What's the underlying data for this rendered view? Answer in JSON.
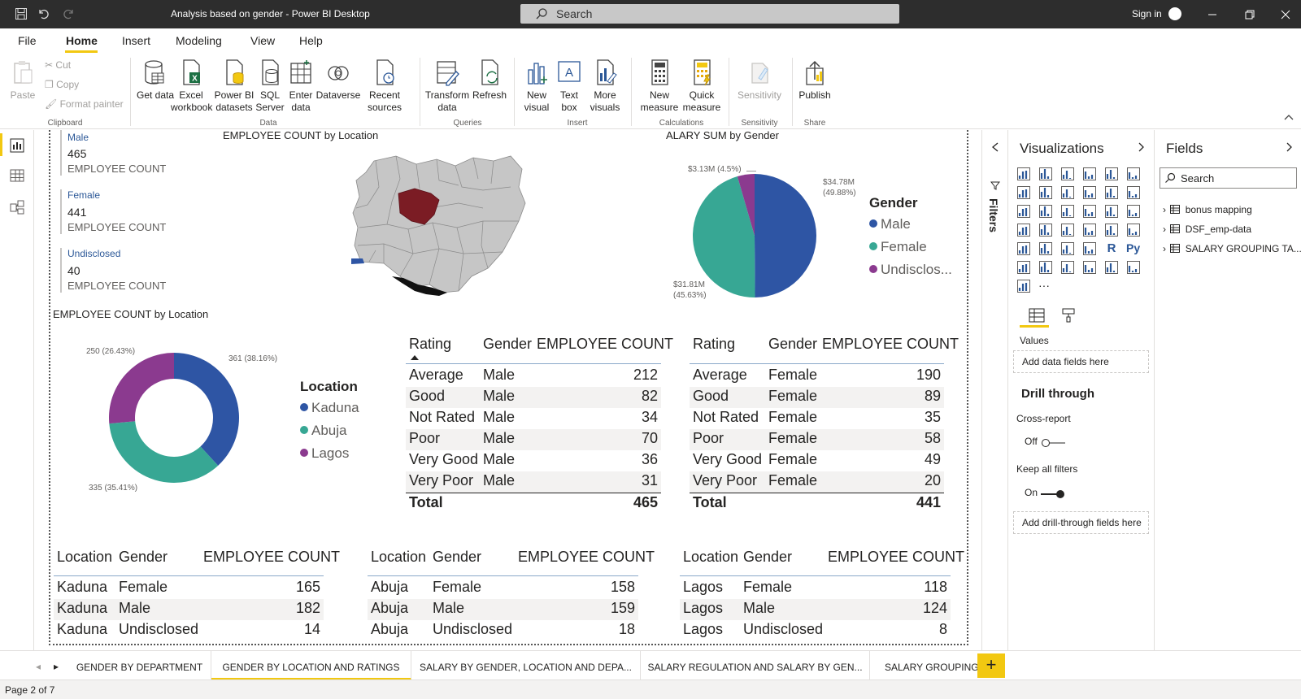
{
  "window": {
    "title": "Analysis based on gender - Power BI Desktop",
    "search_placeholder": "Search",
    "sign_in": "Sign in"
  },
  "menu": [
    "File",
    "Home",
    "Insert",
    "Modeling",
    "View",
    "Help"
  ],
  "ribbon": {
    "clipboard": {
      "paste": "Paste",
      "cut": "Cut",
      "copy": "Copy",
      "format_painter": "Format painter",
      "group": "Clipboard"
    },
    "data": {
      "get_data": "Get data",
      "excel_workbook": "Excel workbook",
      "power_bi_datasets": "Power BI datasets",
      "sql_server": "SQL Server",
      "enter_data": "Enter data",
      "dataverse": "Dataverse",
      "recent_sources": "Recent sources",
      "group": "Data"
    },
    "queries": {
      "transform_data": "Transform data",
      "refresh": "Refresh",
      "group": "Queries"
    },
    "insert": {
      "new_visual": "New visual",
      "text_box": "Text box",
      "more_visuals": "More visuals",
      "group": "Insert"
    },
    "calculations": {
      "new_measure": "New measure",
      "quick_measure": "Quick measure",
      "group": "Calculations"
    },
    "sensitivity": {
      "sensitivity": "Sensitivity",
      "group": "Sensitivity"
    },
    "share": {
      "publish": "Publish",
      "group": "Share"
    }
  },
  "cards": [
    {
      "label": "Male",
      "value": "465",
      "sub": "EMPLOYEE COUNT"
    },
    {
      "label": "Female",
      "value": "441",
      "sub": "EMPLOYEE COUNT"
    },
    {
      "label": "Undisclosed",
      "value": "40",
      "sub": "EMPLOYEE COUNT"
    }
  ],
  "map": {
    "title": "EMPLOYEE COUNT by Location"
  },
  "colors": {
    "male": "#2e55a4",
    "female": "#37a794",
    "undisclosed": "#8b3a8f",
    "accent": "#f2c811",
    "map_highlight": "#7b1c24"
  },
  "chart_data": [
    {
      "type": "pie",
      "title": "ALARY SUM by Gender",
      "legend_title": "Gender",
      "categories": [
        "Male",
        "Female",
        "Undisclos..."
      ],
      "values": [
        34.78,
        31.81,
        3.13
      ],
      "value_labels": [
        "$34.78M (49.88%)",
        "$31.81M (45.63%)",
        "$3.13M (4.5%)"
      ],
      "legend_position": "right"
    },
    {
      "type": "pie",
      "title": "EMPLOYEE COUNT by Location",
      "legend_title": "Location",
      "categories": [
        "Kaduna",
        "Abuja",
        "Lagos"
      ],
      "values": [
        361,
        335,
        250
      ],
      "value_labels": [
        "361 (38.16%)",
        "335 (35.41%)",
        "250 (26.43%)"
      ],
      "donut": true,
      "legend_position": "right"
    }
  ],
  "rating_tables": [
    {
      "headers": [
        "Rating",
        "Gender",
        "EMPLOYEE COUNT"
      ],
      "rows": [
        [
          "Average",
          "Male",
          "212"
        ],
        [
          "Good",
          "Male",
          "82"
        ],
        [
          "Not Rated",
          "Male",
          "34"
        ],
        [
          "Poor",
          "Male",
          "70"
        ],
        [
          "Very Good",
          "Male",
          "36"
        ],
        [
          "Very Poor",
          "Male",
          "31"
        ]
      ],
      "total": [
        "Total",
        "465"
      ]
    },
    {
      "headers": [
        "Rating",
        "Gender",
        "EMPLOYEE COUNT"
      ],
      "rows": [
        [
          "Average",
          "Female",
          "190"
        ],
        [
          "Good",
          "Female",
          "89"
        ],
        [
          "Not Rated",
          "Female",
          "35"
        ],
        [
          "Poor",
          "Female",
          "58"
        ],
        [
          "Very Good",
          "Female",
          "49"
        ],
        [
          "Very Poor",
          "Female",
          "20"
        ]
      ],
      "total": [
        "Total",
        "441"
      ]
    }
  ],
  "location_tables": [
    {
      "headers": [
        "Location",
        "Gender",
        "EMPLOYEE COUNT"
      ],
      "rows": [
        [
          "Kaduna",
          "Female",
          "165"
        ],
        [
          "Kaduna",
          "Male",
          "182"
        ],
        [
          "Kaduna",
          "Undisclosed",
          "14"
        ]
      ]
    },
    {
      "headers": [
        "Location",
        "Gender",
        "EMPLOYEE COUNT"
      ],
      "rows": [
        [
          "Abuja",
          "Female",
          "158"
        ],
        [
          "Abuja",
          "Male",
          "159"
        ],
        [
          "Abuja",
          "Undisclosed",
          "18"
        ]
      ]
    },
    {
      "headers": [
        "Location",
        "Gender",
        "EMPLOYEE COUNT"
      ],
      "rows": [
        [
          "Lagos",
          "Female",
          "118"
        ],
        [
          "Lagos",
          "Male",
          "124"
        ],
        [
          "Lagos",
          "Undisclosed",
          "8"
        ]
      ]
    }
  ],
  "panes": {
    "filters": "Filters",
    "visualizations": {
      "title": "Visualizations",
      "values": "Values",
      "add_data_fields": "Add data fields here",
      "drill_through": "Drill through",
      "cross_report": "Cross-report",
      "cross_report_state": "Off",
      "keep_all_filters": "Keep all filters",
      "keep_all_filters_state": "On",
      "add_drill_fields": "Add drill-through fields here"
    },
    "fields": {
      "title": "Fields",
      "search_placeholder": "Search",
      "items": [
        "bonus mapping",
        "DSF_emp-data",
        "SALARY GROUPING TA..."
      ]
    }
  },
  "tabs": [
    "GENDER BY DEPARTMENT",
    "GENDER BY LOCATION AND RATINGS",
    "SALARY BY GENDER, LOCATION AND DEPA...",
    "SALARY REGULATION AND SALARY BY GEN...",
    "SALARY GROUPING"
  ],
  "active_tab": "GENDER BY LOCATION AND RATINGS",
  "status": "Page 2 of 7"
}
